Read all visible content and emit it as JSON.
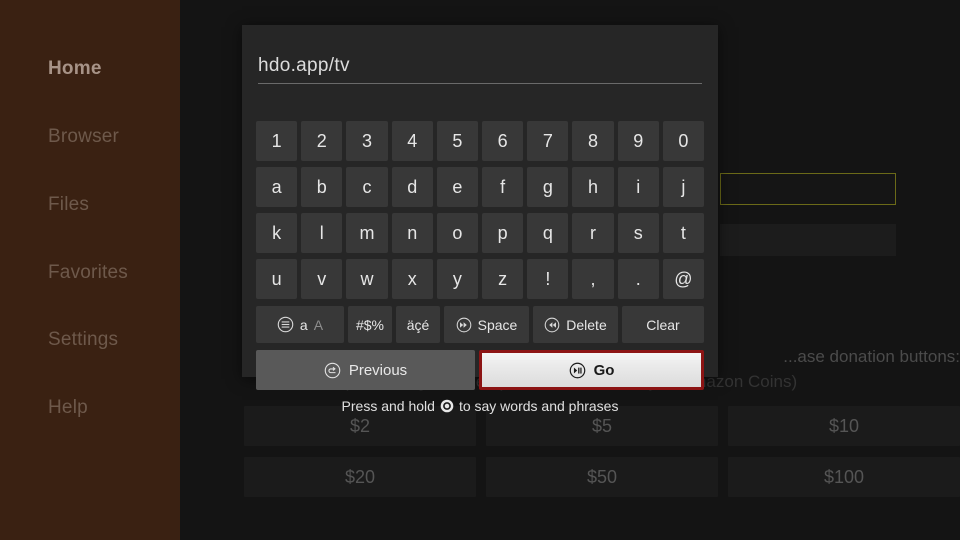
{
  "sidebar": {
    "items": [
      {
        "label": "Home",
        "selected": true
      },
      {
        "label": "Browser",
        "selected": false
      },
      {
        "label": "Files",
        "selected": false
      },
      {
        "label": "Favorites",
        "selected": false
      },
      {
        "label": "Settings",
        "selected": false
      },
      {
        "label": "Help",
        "selected": false
      }
    ]
  },
  "background": {
    "lead_text": "...ase donation buttons:",
    "sub_text": "(You'll be given the option to use currency or Amazon Coins)",
    "donation_buttons": [
      "$2",
      "$5",
      "$10",
      "$20",
      "$50",
      "$100"
    ],
    "highlight_box_color": "#6b6a18"
  },
  "keyboard": {
    "input_value": "hdo.app/tv",
    "input_placeholder": "",
    "rows": [
      [
        "1",
        "2",
        "3",
        "4",
        "5",
        "6",
        "7",
        "8",
        "9",
        "0"
      ],
      [
        "a",
        "b",
        "c",
        "d",
        "e",
        "f",
        "g",
        "h",
        "i",
        "j"
      ],
      [
        "k",
        "l",
        "m",
        "n",
        "o",
        "p",
        "q",
        "r",
        "s",
        "t"
      ],
      [
        "u",
        "v",
        "w",
        "x",
        "y",
        "z",
        "!",
        ",",
        ".",
        "@"
      ]
    ],
    "function_keys": {
      "case_lower": "a",
      "case_upper": "A",
      "symbols": "#$%",
      "accents": "äçé",
      "space": "Space",
      "delete": "Delete",
      "clear": "Clear"
    },
    "actions": {
      "previous": "Previous",
      "go": "Go"
    },
    "voice_hint_before": "Press and hold",
    "voice_hint_after": "to say words and phrases",
    "focus_color": "#8c1414"
  }
}
